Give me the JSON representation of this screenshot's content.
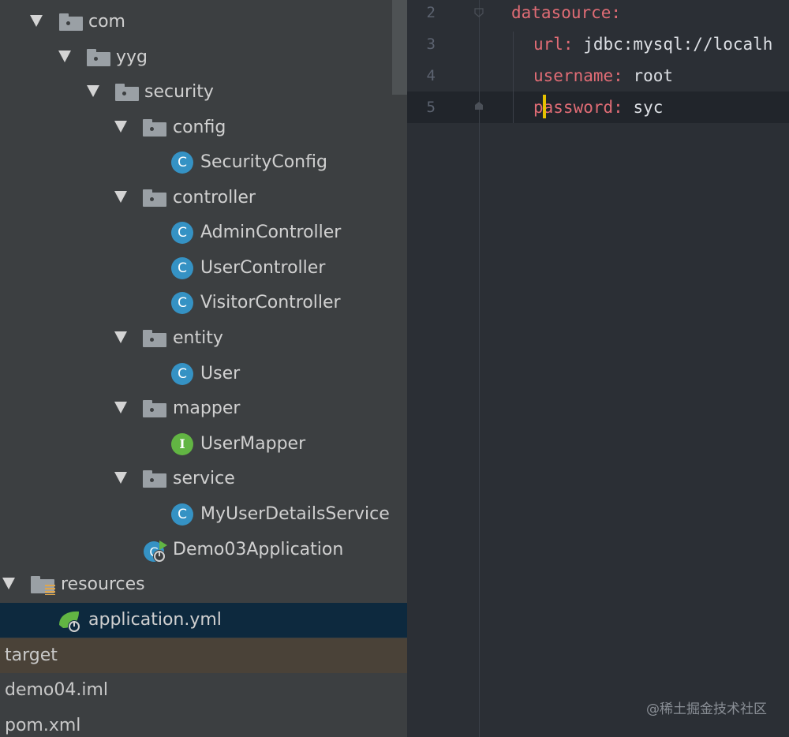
{
  "project_tree": {
    "com": "com",
    "yyg": "yyg",
    "security": "security",
    "config": "config",
    "security_config": "SecurityConfig",
    "controller": "controller",
    "admin_controller": "AdminController",
    "user_controller": "UserController",
    "visitor_controller": "VisitorController",
    "entity": "entity",
    "user": "User",
    "mapper": "mapper",
    "user_mapper": "UserMapper",
    "service": "service",
    "my_user_details_service": "MyUserDetailsService",
    "demo03_application": "Demo03Application",
    "resources": "resources",
    "application_yml": "application.yml",
    "target": "target",
    "demo04_iml": "demo04.iml",
    "pom_xml": "pom.xml",
    "class_badge": "C",
    "interface_badge": "I"
  },
  "editor": {
    "lines": [
      {
        "number": "2",
        "key": "datasource:",
        "value": ""
      },
      {
        "number": "3",
        "key": "url:",
        "value": " jdbc:mysql://localh"
      },
      {
        "number": "4",
        "key": "username:",
        "value": " root"
      },
      {
        "number": "5",
        "key": "password:",
        "value": " syc"
      }
    ]
  },
  "watermark": "@稀土掘金技术社区",
  "colors": {
    "panel_bg": "#3c3f41",
    "editor_bg": "#2b2f35",
    "selection": "#0d293e",
    "yaml_key": "#e06c75",
    "class_icon": "#3592c4",
    "interface_icon": "#62b543"
  },
  "icons": {
    "folder": "package-folder-icon",
    "resources": "resources-folder-icon",
    "class": "java-class-icon",
    "interface": "java-interface-icon",
    "spring": "spring-boot-icon"
  }
}
